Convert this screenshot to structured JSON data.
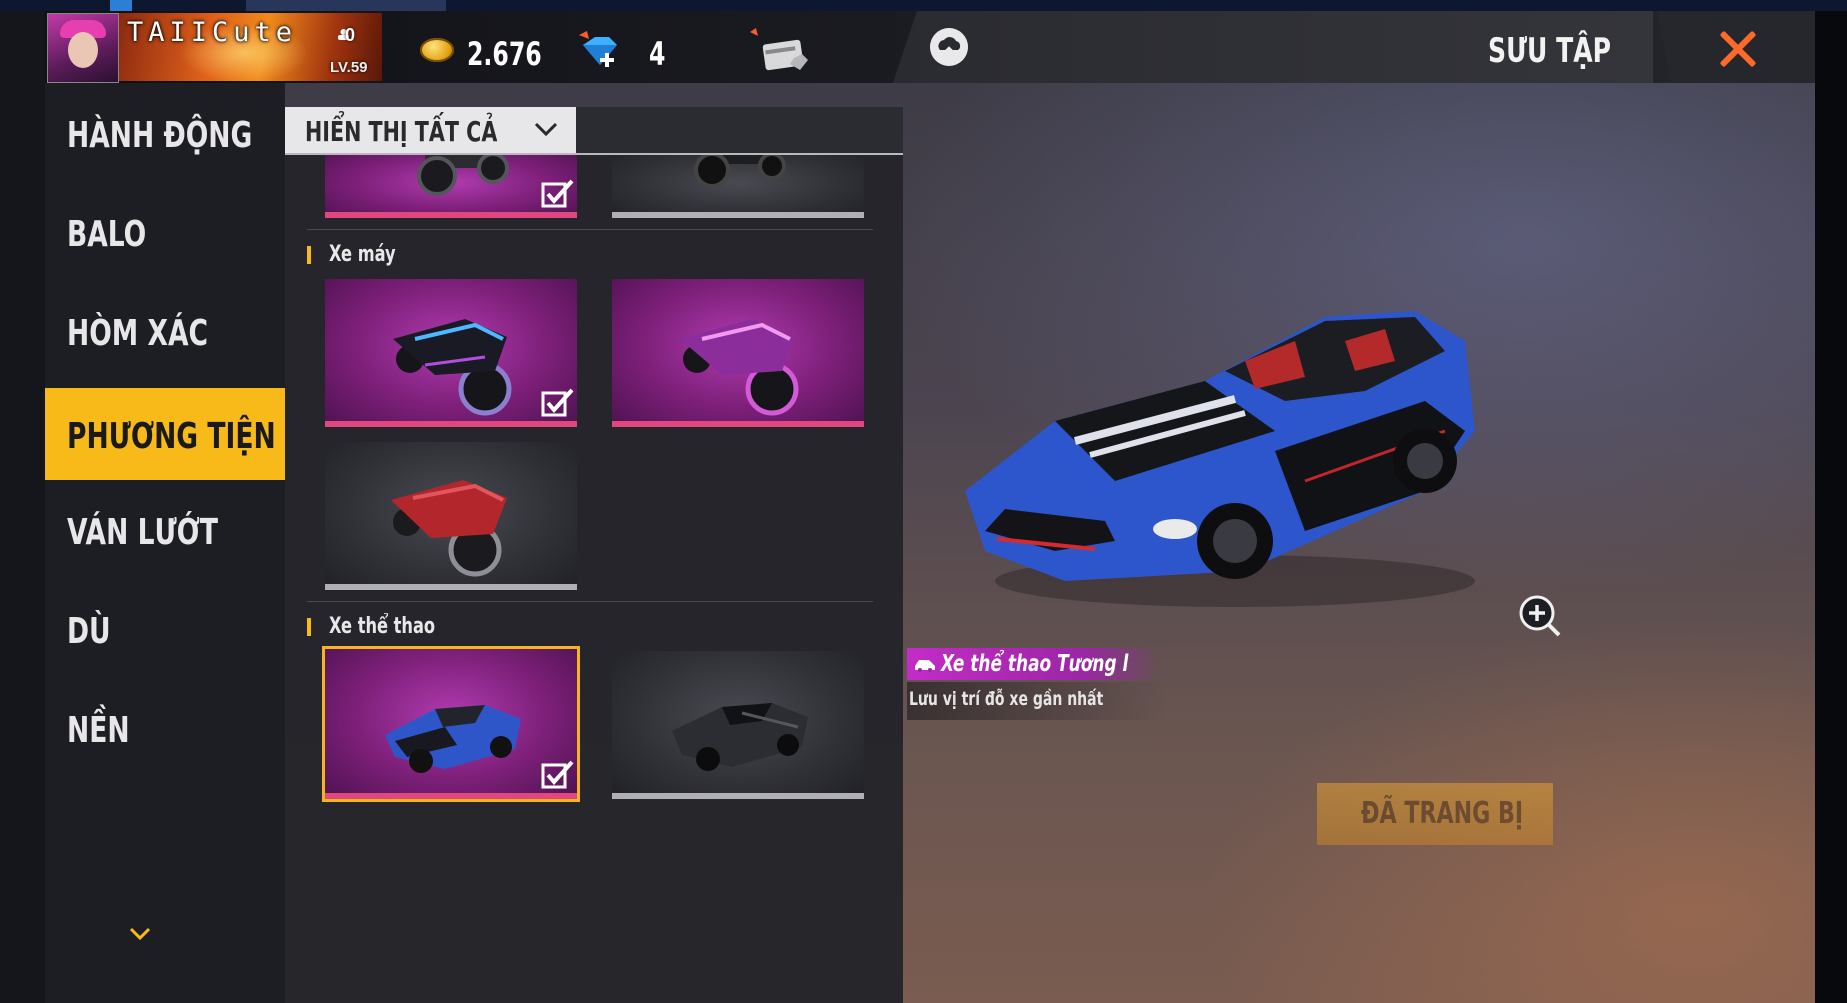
{
  "player": {
    "name": "TAIICute",
    "level": "LV.59",
    "likes": "0"
  },
  "currency": {
    "gold": "2.676",
    "diamonds": "4"
  },
  "header": {
    "title": "SƯU TẬP"
  },
  "nav": {
    "items": [
      {
        "label": "HÀNH ĐỘNG"
      },
      {
        "label": "BALO"
      },
      {
        "label": "HÒM XÁC"
      },
      {
        "label": "PHƯƠNG TIỆN"
      },
      {
        "label": "VÁN LƯỚT"
      },
      {
        "label": "DÙ"
      },
      {
        "label": "NỀN"
      }
    ],
    "active": "PHƯƠNG TIỆN"
  },
  "filter": {
    "label": "HIỂN THỊ TẤT CẢ"
  },
  "sections": {
    "motorbike": "Xe máy",
    "sportscar": "Xe thể thao"
  },
  "preview": {
    "item_name": "Xe thể thao Tương l",
    "description": "Lưu vị trí đỗ xe gần nhất",
    "equip_label": "ĐÃ TRANG BỊ"
  },
  "colors": {
    "accent": "#f7ba18",
    "tile_purple": "#7c1f78",
    "close": "#ff6a2b",
    "banner": "#c32cc7"
  },
  "icons": [
    "user-avatar",
    "coin-icon",
    "diamond-icon",
    "card-icon",
    "cloud-icon",
    "close-icon",
    "chevron-down-icon",
    "checkmark-icon",
    "zoom-in-icon",
    "car-icon"
  ]
}
